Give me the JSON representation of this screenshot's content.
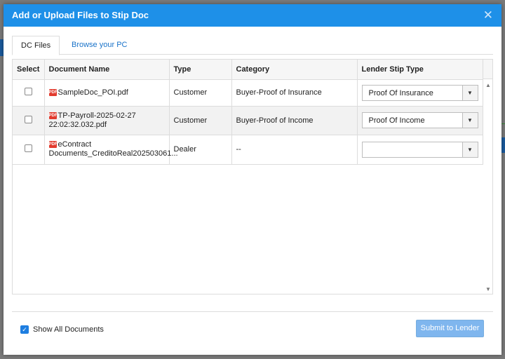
{
  "dialog": {
    "title": "Add or Upload Files to Stip Doc",
    "close_glyph": "✕"
  },
  "tabs": [
    {
      "label": "DC Files",
      "active": true
    },
    {
      "label": "Browse your PC",
      "active": false
    }
  ],
  "grid": {
    "columns": [
      "Select",
      "Document Name",
      "Type",
      "Category",
      "Lender Stip Type"
    ],
    "rows": [
      {
        "checked": false,
        "doc_name_line1": "SampleDoc_POI.pdf",
        "doc_name_line2": "",
        "type": "Customer",
        "category": "Buyer-Proof of Insurance",
        "lender_stip_type": "Proof Of Insurance"
      },
      {
        "checked": false,
        "doc_name_line1": "TP-Payroll-2025-02-27",
        "doc_name_line2": "22:02:32.032.pdf",
        "type": "Customer",
        "category": "Buyer-Proof of Income",
        "lender_stip_type": "Proof Of Income"
      },
      {
        "checked": false,
        "doc_name_line1": "eContract",
        "doc_name_line2": "Documents_CreditoReal202503061...",
        "type": "Dealer",
        "category": "--",
        "lender_stip_type": ""
      }
    ],
    "icons": {
      "file": "pdf-file-icon",
      "dropdown": "chevron-down-icon"
    }
  },
  "footer": {
    "show_all_label": "Show All Documents",
    "show_all_checked": true,
    "submit_label": "Submit to Lender"
  },
  "colors": {
    "header": "#1e90e8",
    "link": "#1a73c9",
    "submit_disabled": "#7fb6ee",
    "checkbox_checked": "#1e7ee0"
  }
}
